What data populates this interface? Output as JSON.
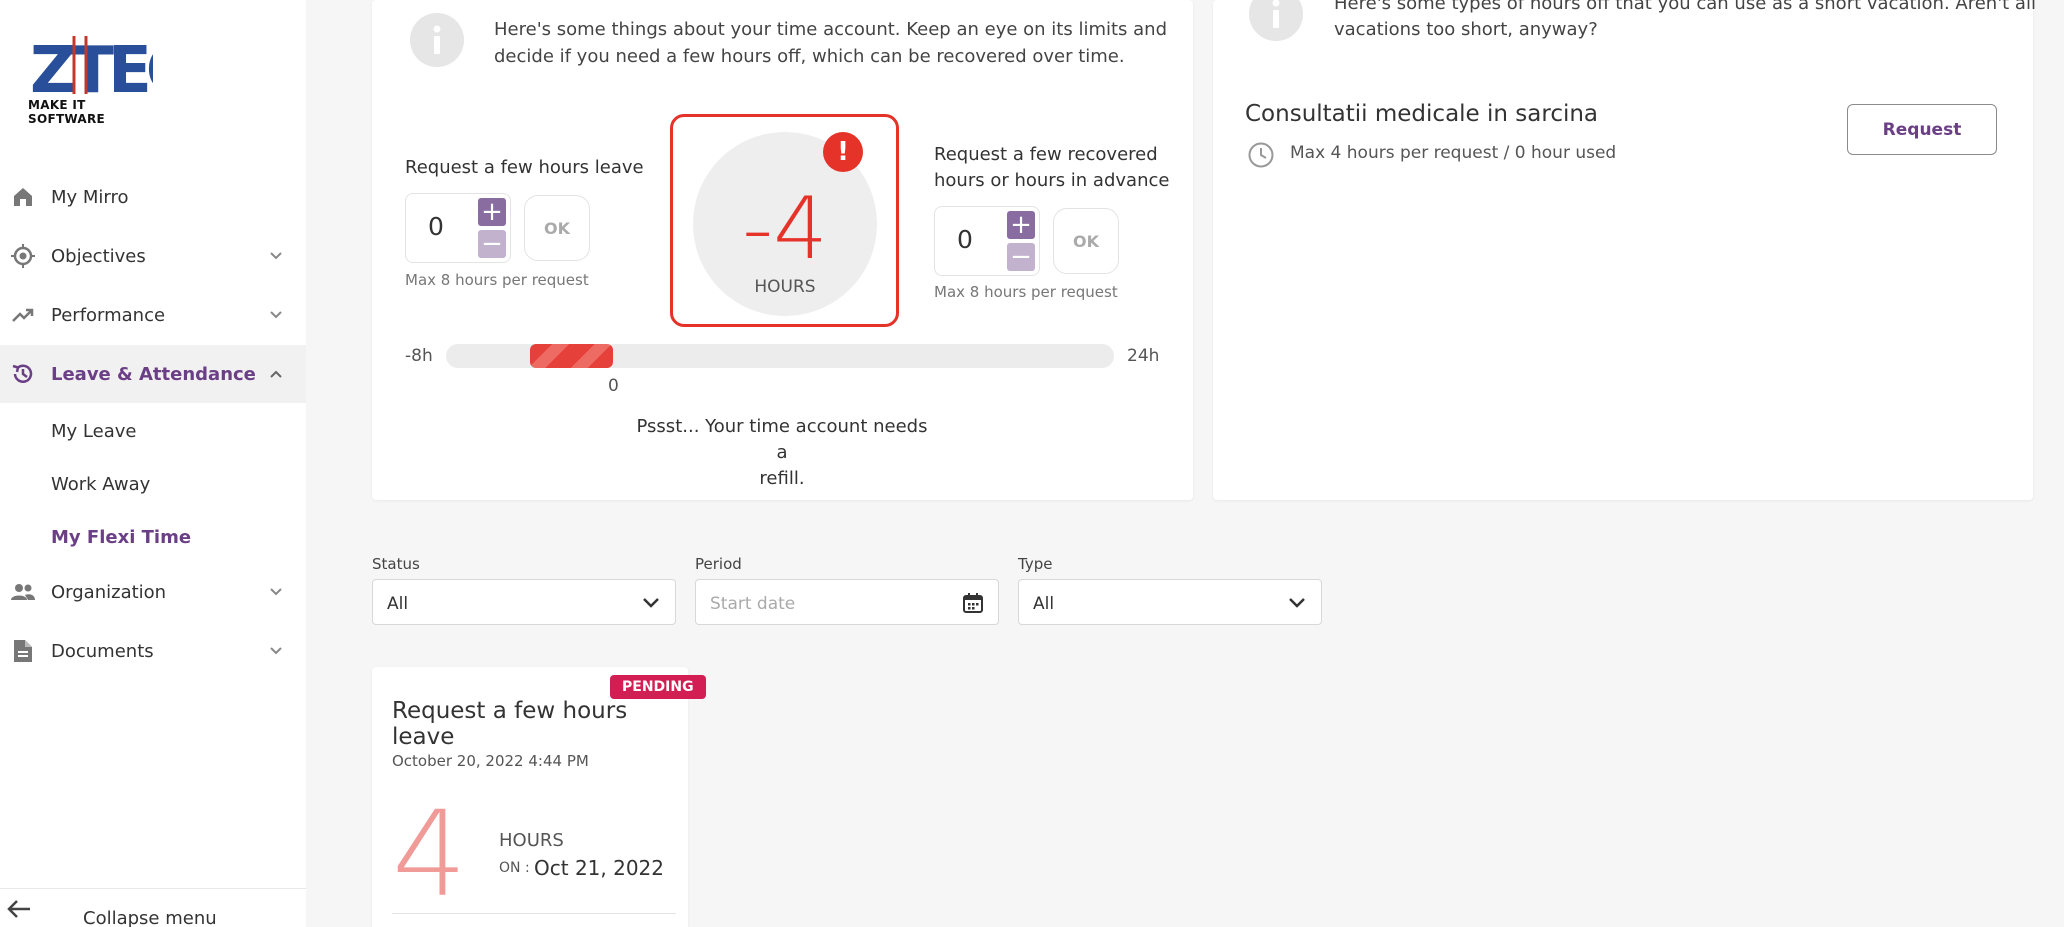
{
  "sidebar": {
    "logo_main": "ZTEC",
    "logo_tagline": "MAKE IT SOFTWARE",
    "items": [
      {
        "label": "My Mirro",
        "icon": "home-icon"
      },
      {
        "label": "Objectives",
        "icon": "target-icon"
      },
      {
        "label": "Performance",
        "icon": "trending-up-icon"
      },
      {
        "label": "Leave & Attendance",
        "icon": "history-icon"
      },
      {
        "label": "Organization",
        "icon": "people-icon"
      },
      {
        "label": "Documents",
        "icon": "document-icon"
      }
    ],
    "sub_items": [
      "My Leave",
      "Work Away",
      "My Flexi Time"
    ],
    "collapse_label": "Collapse menu"
  },
  "time_account": {
    "info_text_line1": "Here's some things about your time account. Keep an eye on its limits and",
    "info_text_line2": "decide if you need a few hours off, which can be recovered over time.",
    "leave": {
      "label": "Request a few hours leave",
      "value": "0",
      "plus": "+",
      "minus": "−",
      "ok": "OK",
      "note": "Max 8 hours per request"
    },
    "recover": {
      "label_line1": "Request a few recovered",
      "label_line2": "hours or hours in advance",
      "value": "0",
      "plus": "+",
      "minus": "−",
      "ok": "OK",
      "note": "Max 8 hours per request"
    },
    "balance": {
      "value": "-4",
      "unit": "HOURS",
      "alert": "!"
    },
    "range": {
      "min_label": "-8h",
      "max_label": "24h",
      "zero_label": "0",
      "min": -8,
      "max": 24,
      "current": -4
    },
    "refill_line1": "Pssst... Your time account needs a",
    "refill_line2": "refill."
  },
  "hours_off": {
    "info_text_line1": "Here's some types of hours off that you can use as a short vacation. Aren't all",
    "info_text_line2": "vacations too short, anyway?",
    "type_title": "Consultatii medicale in sarcina",
    "type_sub": "Max 4 hours per request / 0 hour used",
    "request_button": "Request"
  },
  "filters": {
    "status_label": "Status",
    "status_value": "All",
    "period_label": "Period",
    "period_placeholder": "Start date",
    "type_label": "Type",
    "type_value": "All"
  },
  "request_card": {
    "badge": "PENDING",
    "title": "Request a few hours leave",
    "date": "October 20, 2022 4:44 PM",
    "hours": "4",
    "unit": "HOURS",
    "on_label": "ON :",
    "on_date": "Oct 21, 2022"
  },
  "colors": {
    "accent": "#6b3f86",
    "danger": "#e53329",
    "badge": "#d21e53"
  }
}
